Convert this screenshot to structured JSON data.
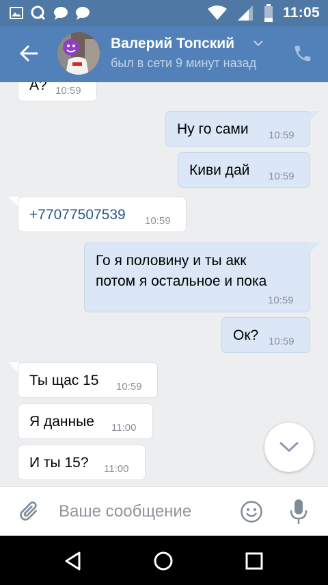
{
  "status_bar": {
    "time": "11:05",
    "icons": [
      "image-icon",
      "q-app-icon",
      "message-bubble-icon",
      "message-bubble-icon",
      "wifi-icon",
      "signal-icon",
      "battery-icon"
    ]
  },
  "header": {
    "name": "Валерий Топский",
    "status": "был в сети 9 минут назад",
    "accent": "#5181b8"
  },
  "messages": [
    {
      "dir": "in",
      "text": "А?",
      "time": "10:59"
    },
    {
      "dir": "out",
      "text": "Ну го сами",
      "time": "10:59"
    },
    {
      "dir": "out",
      "text": "Киви дай",
      "time": "10:59"
    },
    {
      "dir": "in",
      "text": "+77077507539",
      "time": "10:59",
      "link": true
    },
    {
      "dir": "out",
      "lines": [
        "Го я половину и ты акк",
        "потом я остальное и пока"
      ],
      "time": "10:59"
    },
    {
      "dir": "out",
      "text": "Ок?",
      "time": "10:59"
    },
    {
      "dir": "in",
      "text": "Ты щас 15",
      "time": "10:59"
    },
    {
      "dir": "in",
      "text": "Я данные",
      "time": "11:00"
    },
    {
      "dir": "in",
      "text": "И ты 15?",
      "time": "11:00"
    }
  ],
  "composer": {
    "placeholder": "Ваше сообщение"
  }
}
